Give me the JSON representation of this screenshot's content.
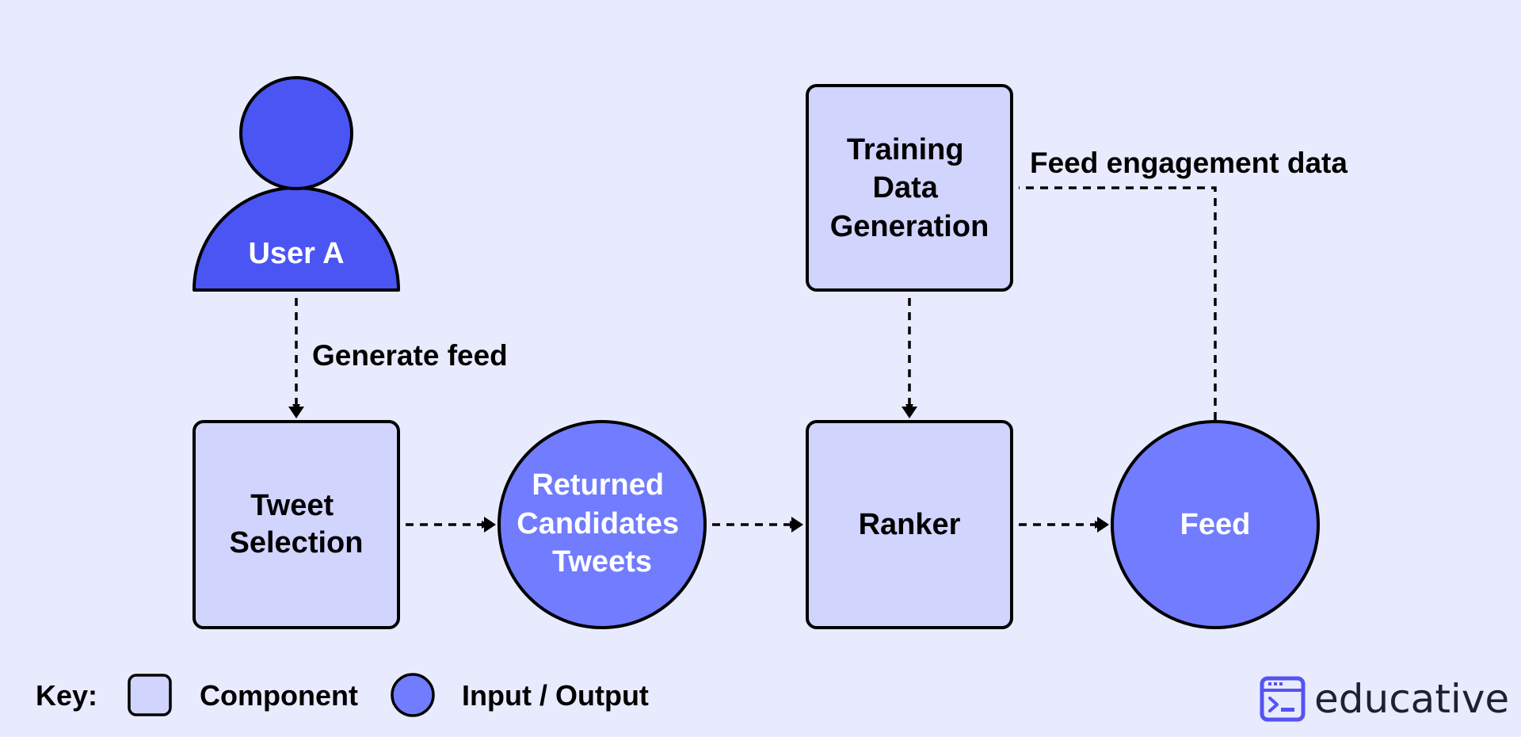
{
  "diagram": {
    "colors": {
      "background": "#e8ebfe",
      "component_fill": "#d1d4fd",
      "io_fill": "#717cfe",
      "user_fill": "#4a55f4",
      "stroke": "#000000",
      "logo_accent": "#5553f2"
    },
    "nodes": {
      "user": {
        "type": "actor",
        "lines": [
          "User A"
        ]
      },
      "tweet_selection": {
        "type": "component",
        "lines": [
          "Tweet",
          "Selection"
        ]
      },
      "returned_candidates": {
        "type": "input_output",
        "lines": [
          "Returned",
          "Candidates",
          "Tweets"
        ]
      },
      "training_data": {
        "type": "component",
        "lines": [
          "Training",
          "Data",
          "Generation"
        ]
      },
      "ranker": {
        "type": "component",
        "lines": [
          "Ranker"
        ]
      },
      "feed": {
        "type": "input_output",
        "lines": [
          "Feed"
        ]
      }
    },
    "edges": [
      {
        "from": "user",
        "to": "tweet_selection",
        "label": "Generate feed",
        "style": "dashed"
      },
      {
        "from": "tweet_selection",
        "to": "returned_candidates",
        "label": "",
        "style": "dashed"
      },
      {
        "from": "returned_candidates",
        "to": "ranker",
        "label": "",
        "style": "dashed"
      },
      {
        "from": "training_data",
        "to": "ranker",
        "label": "",
        "style": "dashed"
      },
      {
        "from": "ranker",
        "to": "feed",
        "label": "",
        "style": "dashed"
      },
      {
        "from": "feed",
        "to": "training_data",
        "label": "Feed engagement data",
        "style": "dashed"
      }
    ],
    "labels": {
      "generate_feed": "Generate feed",
      "feed_engagement": "Feed engagement data"
    }
  },
  "key": {
    "title": "Key:",
    "component": "Component",
    "io": "Input / Output"
  },
  "logo": {
    "text": "educative",
    "icon": "terminal-window-icon"
  }
}
